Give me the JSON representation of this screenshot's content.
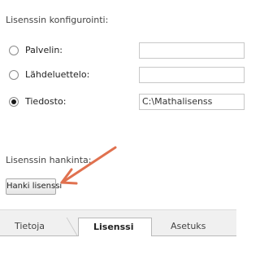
{
  "license_config": {
    "heading": "Lisenssin konfigurointi:",
    "options": [
      {
        "label": "Palvelin:",
        "checked": false,
        "value": ""
      },
      {
        "label": "Lähdeluettelo:",
        "checked": false,
        "value": ""
      },
      {
        "label": "Tiedosto:",
        "checked": true,
        "value": "C:\\Mathalisenss"
      }
    ]
  },
  "license_acquire": {
    "heading": "Lisenssin hankinta:",
    "button_label": "Hanki lisenssi"
  },
  "tabs": [
    {
      "label": "Tietoja",
      "active": false
    },
    {
      "label": "Lisenssi",
      "active": true
    },
    {
      "label": "Asetuks",
      "active": false
    }
  ],
  "annotation": {
    "arrow_color": "#e0714f"
  }
}
